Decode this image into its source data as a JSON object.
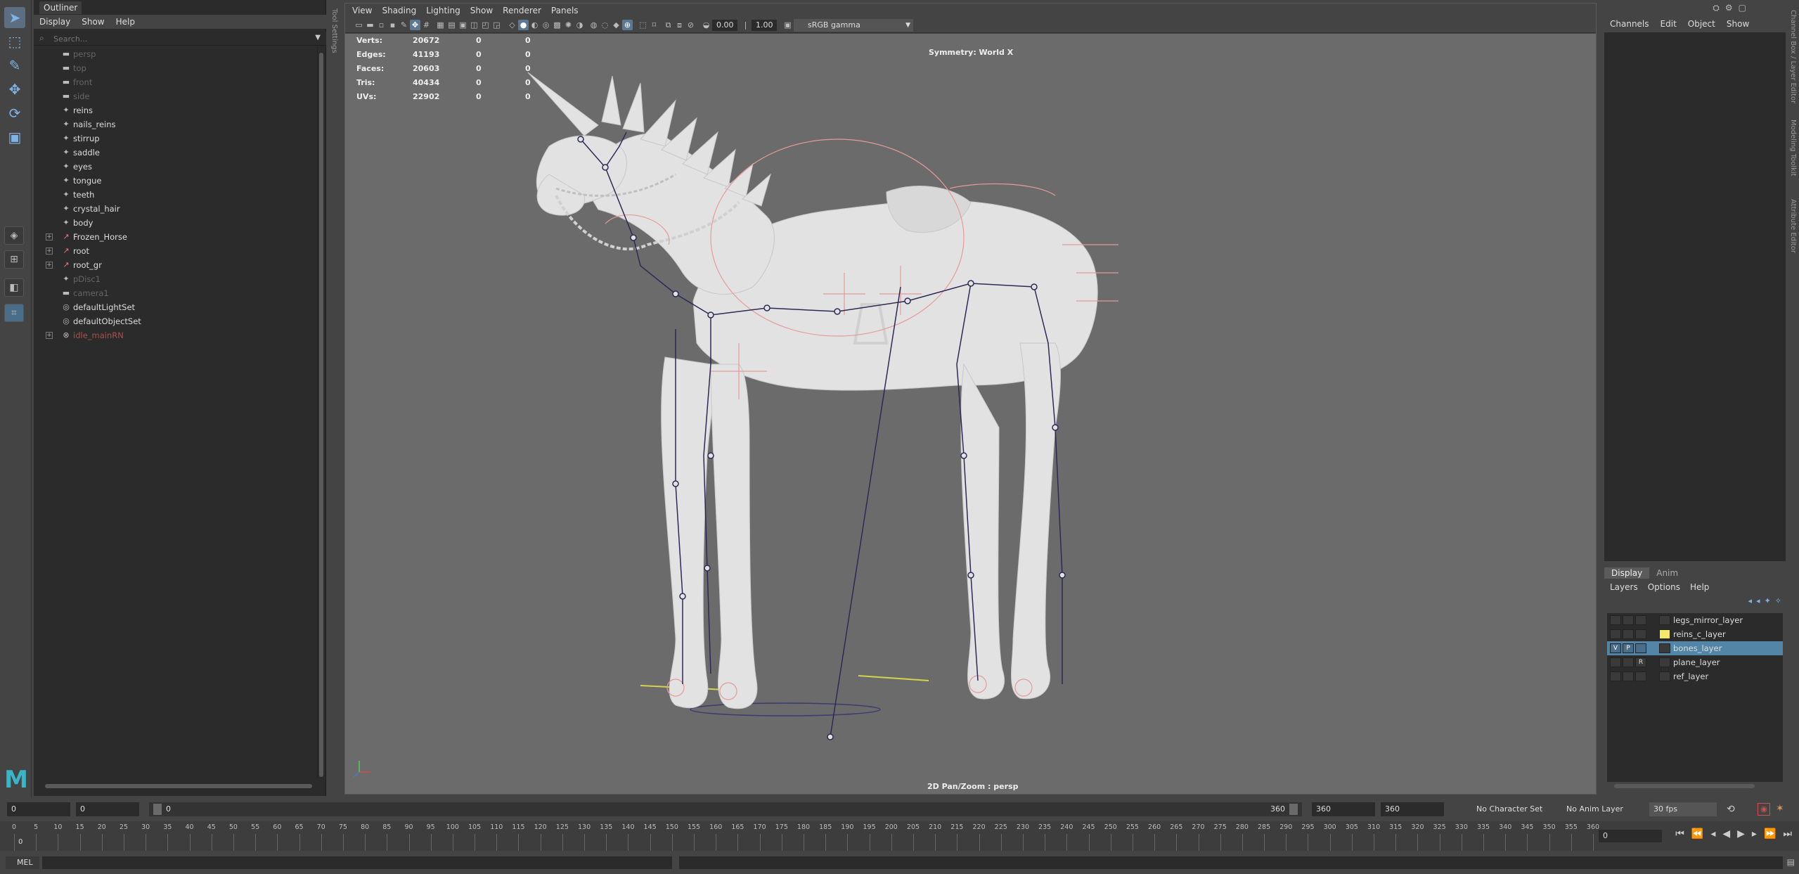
{
  "outliner": {
    "title": "Outliner",
    "menu": [
      "Display",
      "Show",
      "Help"
    ],
    "search_placeholder": "Search...",
    "items": [
      {
        "label": "persp",
        "dim": true,
        "icon": "camera"
      },
      {
        "label": "top",
        "dim": true,
        "icon": "camera"
      },
      {
        "label": "front",
        "dim": true,
        "icon": "camera"
      },
      {
        "label": "side",
        "dim": true,
        "icon": "camera"
      },
      {
        "label": "reins",
        "icon": "mesh"
      },
      {
        "label": "nails_reins",
        "icon": "mesh"
      },
      {
        "label": "stirrup",
        "icon": "mesh"
      },
      {
        "label": "saddle",
        "icon": "mesh"
      },
      {
        "label": "eyes",
        "icon": "mesh"
      },
      {
        "label": "tongue",
        "icon": "mesh"
      },
      {
        "label": "teeth",
        "icon": "mesh"
      },
      {
        "label": "crystal_hair",
        "icon": "mesh"
      },
      {
        "label": "body",
        "icon": "mesh"
      },
      {
        "label": "Frozen_Horse",
        "icon": "joint",
        "expand": true
      },
      {
        "label": "root",
        "icon": "joint",
        "expand": true
      },
      {
        "label": "root_gr",
        "icon": "joint",
        "expand": true
      },
      {
        "label": "pDisc1",
        "dim": true,
        "icon": "mesh"
      },
      {
        "label": "camera1",
        "dim": true,
        "icon": "camera"
      },
      {
        "label": "defaultLightSet",
        "icon": "set"
      },
      {
        "label": "defaultObjectSet",
        "icon": "set"
      },
      {
        "label": "idle_mainRN",
        "red": true,
        "icon": "ref",
        "expand": true
      }
    ]
  },
  "side_tabs": {
    "tool_settings": "Tool Settings",
    "channel_box": "Channel Box / Layer Editor",
    "modeling_toolkit": "Modeling Toolkit",
    "attribute_editor": "Attribute Editor"
  },
  "viewport": {
    "menu": [
      "View",
      "Shading",
      "Lighting",
      "Show",
      "Renderer",
      "Panels"
    ],
    "exposure": "0.00",
    "gamma": "1.00",
    "color_space": "sRGB gamma",
    "symmetry": "Symmetry: World X",
    "camera_label": "2D Pan/Zoom : persp",
    "stats": [
      {
        "label": "Verts:",
        "value": "20672",
        "a": "0",
        "b": "0"
      },
      {
        "label": "Edges:",
        "value": "41193",
        "a": "0",
        "b": "0"
      },
      {
        "label": "Faces:",
        "value": "20603",
        "a": "0",
        "b": "0"
      },
      {
        "label": "Tris:",
        "value": "40434",
        "a": "0",
        "b": "0"
      },
      {
        "label": "UVs:",
        "value": "22902",
        "a": "0",
        "b": "0"
      }
    ]
  },
  "channel_box": {
    "menu": [
      "Channels",
      "Edit",
      "Object",
      "Show"
    ]
  },
  "layer_editor": {
    "tabs": [
      "Display",
      "Anim"
    ],
    "menu": [
      "Layers",
      "Options",
      "Help"
    ],
    "layers": [
      {
        "name": "legs_mirror_layer",
        "v": "",
        "p": "",
        "r": "",
        "color": "",
        "selected": false
      },
      {
        "name": "reins_c_layer",
        "v": "",
        "p": "",
        "r": "",
        "color": "#f2e96b",
        "selected": false
      },
      {
        "name": "bones_layer",
        "v": "V",
        "p": "P",
        "r": "",
        "color": "",
        "selected": true
      },
      {
        "name": "plane_layer",
        "v": "",
        "p": "",
        "r": "R",
        "color": "",
        "selected": false
      },
      {
        "name": "ref_layer",
        "v": "",
        "p": "",
        "r": "",
        "color": "",
        "selected": false
      }
    ]
  },
  "time_range": {
    "start": "0",
    "playback_start": "0",
    "slider_left": "0",
    "slider_right": "360",
    "playback_end": "360",
    "end": "360",
    "character_set": "No Character Set",
    "anim_layer": "No Anim Layer",
    "fps": "30 fps"
  },
  "timeline": {
    "current_frame": "0",
    "frame_field": "0",
    "ticks": [
      0,
      5,
      10,
      15,
      20,
      25,
      30,
      35,
      40,
      45,
      50,
      55,
      60,
      65,
      70,
      75,
      80,
      85,
      90,
      95,
      100,
      105,
      110,
      115,
      120,
      125,
      130,
      135,
      140,
      145,
      150,
      155,
      160,
      165,
      170,
      175,
      180,
      185,
      190,
      195,
      200,
      205,
      210,
      215,
      220,
      225,
      230,
      235,
      240,
      245,
      250,
      255,
      260,
      265,
      270,
      275,
      280,
      285,
      290,
      295,
      300,
      305,
      310,
      315,
      320,
      325,
      330,
      335,
      340,
      345,
      350,
      355,
      360
    ]
  },
  "command_line": {
    "mode": "MEL"
  }
}
